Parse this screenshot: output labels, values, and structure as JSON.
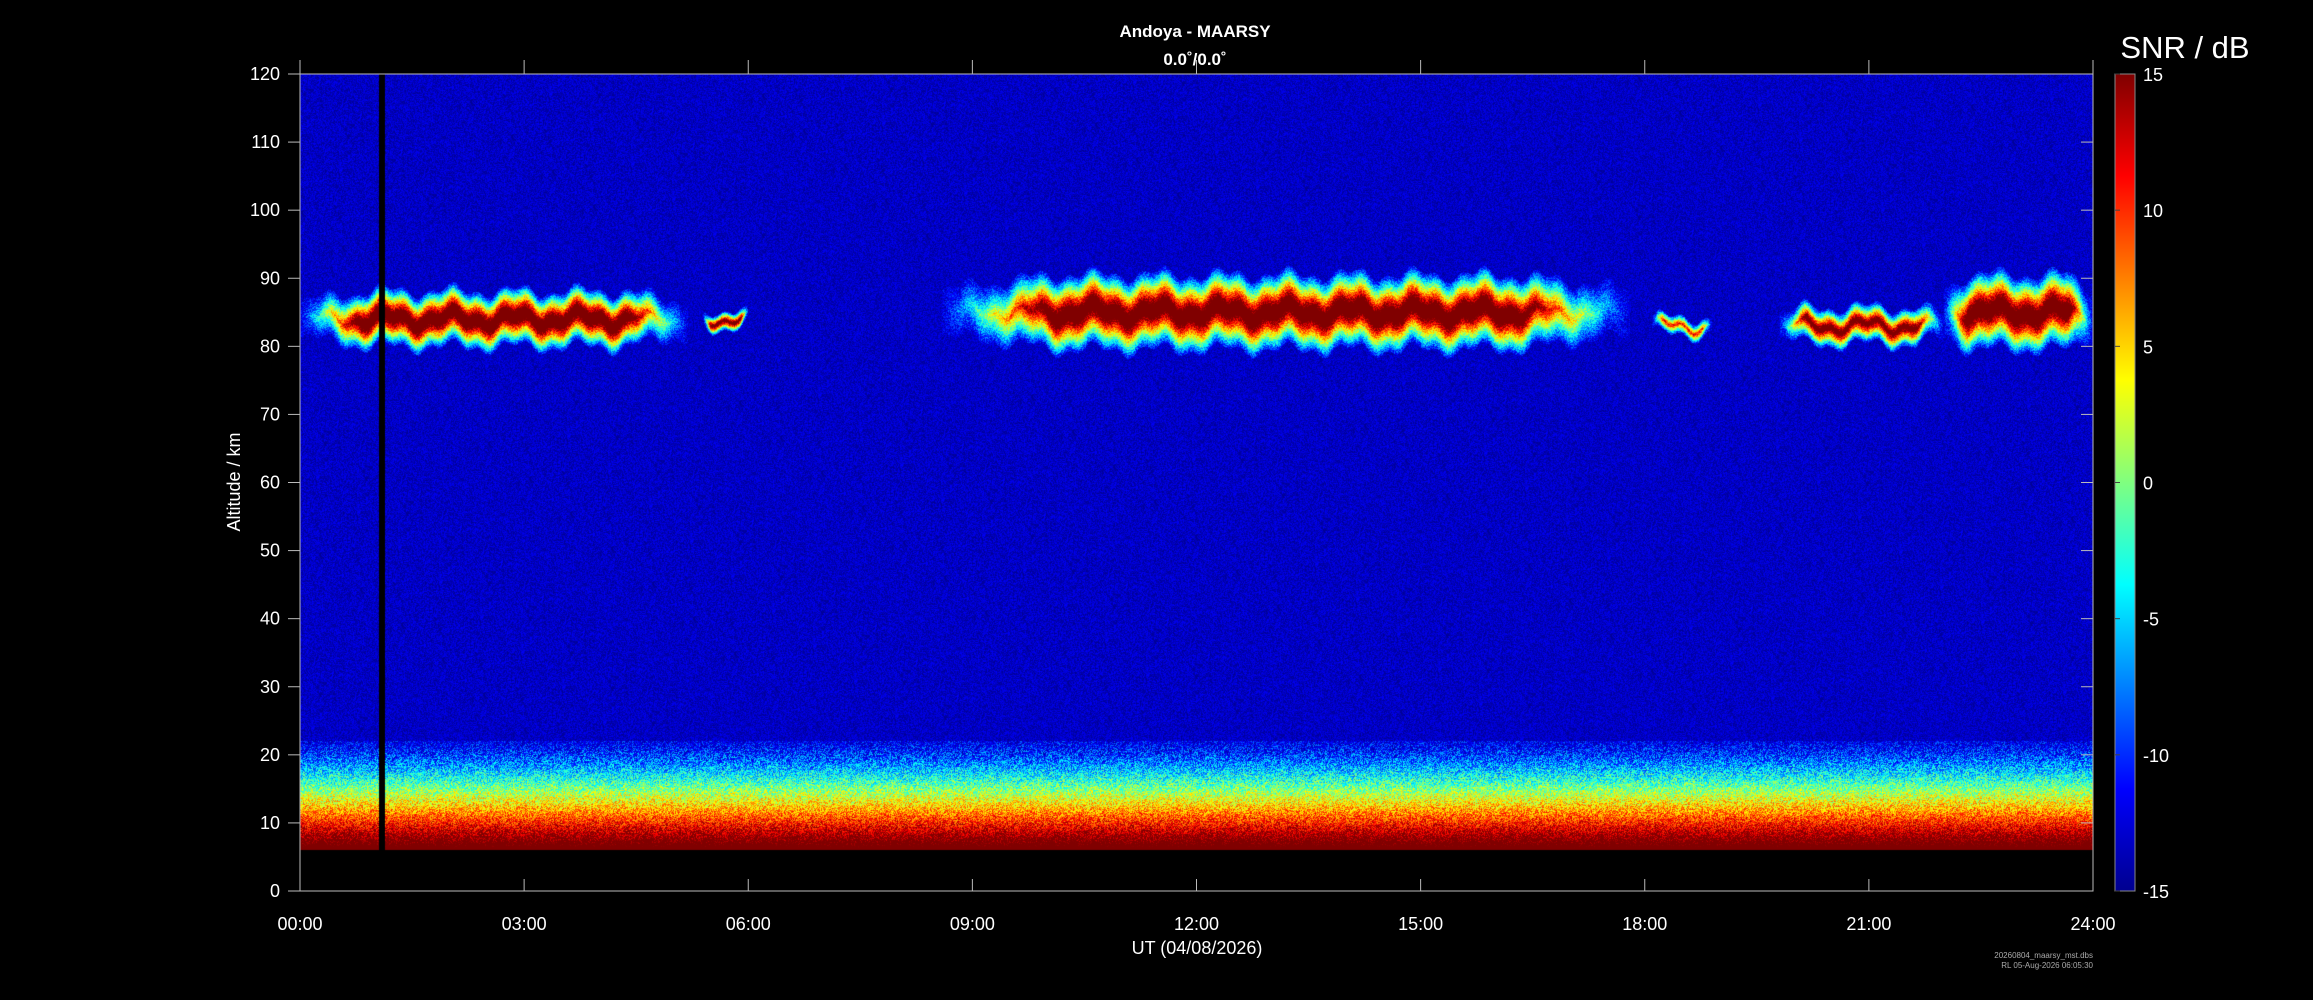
{
  "chart_data": {
    "type": "heatmap",
    "title": "Andoya - MAARSY",
    "subtitle": "0.0˚/0.0˚",
    "xlabel": "UT (04/08/2026)",
    "ylabel": "Altitude / km",
    "x_ticks": [
      "00:00",
      "03:00",
      "06:00",
      "09:00",
      "12:00",
      "15:00",
      "18:00",
      "21:00",
      "24:00"
    ],
    "xlim_hours": [
      0,
      24
    ],
    "y_ticks": [
      0,
      10,
      20,
      30,
      40,
      50,
      60,
      70,
      80,
      90,
      100,
      110,
      120
    ],
    "ylim": [
      0,
      120
    ],
    "data_altitude_range": [
      6,
      120
    ],
    "colorbar": {
      "label": "SNR / dB",
      "range": [
        -15,
        15
      ],
      "ticks": [
        15,
        10,
        5,
        0,
        -5,
        -10,
        -15
      ],
      "colormap": "jet"
    },
    "data_gap_ut_hours": 1.1,
    "background_snr_db": -13,
    "echo_layers": [
      {
        "name": "PMSE",
        "start_h": 0.0,
        "end_h": 5.2,
        "alt_low_km": 81,
        "alt_high_km": 87,
        "peak_snr_db": 15
      },
      {
        "name": "PMSE",
        "start_h": 5.4,
        "end_h": 6.0,
        "alt_low_km": 83,
        "alt_high_km": 85,
        "peak_snr_db": 12
      },
      {
        "name": "PMSE",
        "start_h": 8.6,
        "end_h": 17.8,
        "alt_low_km": 81,
        "alt_high_km": 89,
        "peak_snr_db": 15
      },
      {
        "name": "PMSE",
        "start_h": 18.1,
        "end_h": 18.9,
        "alt_low_km": 82,
        "alt_high_km": 84,
        "peak_snr_db": 6
      },
      {
        "name": "PMSE",
        "start_h": 19.8,
        "end_h": 22.0,
        "alt_low_km": 81,
        "alt_high_km": 85,
        "peak_snr_db": 12
      },
      {
        "name": "PMSE",
        "start_h": 22.0,
        "end_h": 24.0,
        "alt_low_km": 81,
        "alt_high_km": 89,
        "peak_snr_db": 15
      }
    ],
    "lower_atmosphere_echo": {
      "alt_low_km": 6,
      "alt_high_km": 22,
      "peak_snr_db": 15
    }
  },
  "footer": {
    "line1": "20260804_maarsy_mst.dbs",
    "line2": "RL 05-Aug-2026 06:05:30"
  }
}
